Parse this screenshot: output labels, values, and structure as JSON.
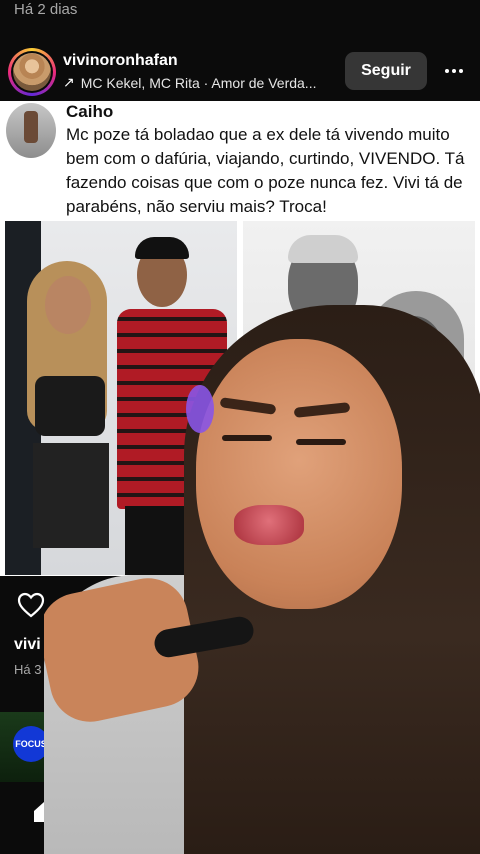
{
  "top": {
    "timestamp": "Há 2 dias"
  },
  "header": {
    "username": "vivinoronhafan",
    "music": "MC Kekel, MC Rita · Amor de Verda...",
    "follow_label": "Seguir"
  },
  "tweet": {
    "name": "Caiho",
    "text": "Mc poze tá boladao que a ex dele tá vivendo muito bem com o dafúria, viajando, curtindo, VIVENDO. Tá fazendo coisas que com o poze nunca fez. Vivi tá de parabéns, não serviu mais? Troca!"
  },
  "caption": {
    "username_partial": "vivi",
    "time_partial": "Há 3"
  },
  "next_post": {
    "logo_text": "FOCUS"
  },
  "icons": {
    "more": "more-horizontal-icon",
    "arrow": "repost-arrow-icon",
    "sound": "sound-icon",
    "like": "heart-icon",
    "save": "bookmark-icon",
    "home": "home-icon"
  },
  "colors": {
    "background": "#0b0b0b",
    "follow_button": "#363636",
    "meta_text": "#a8a8a8"
  }
}
